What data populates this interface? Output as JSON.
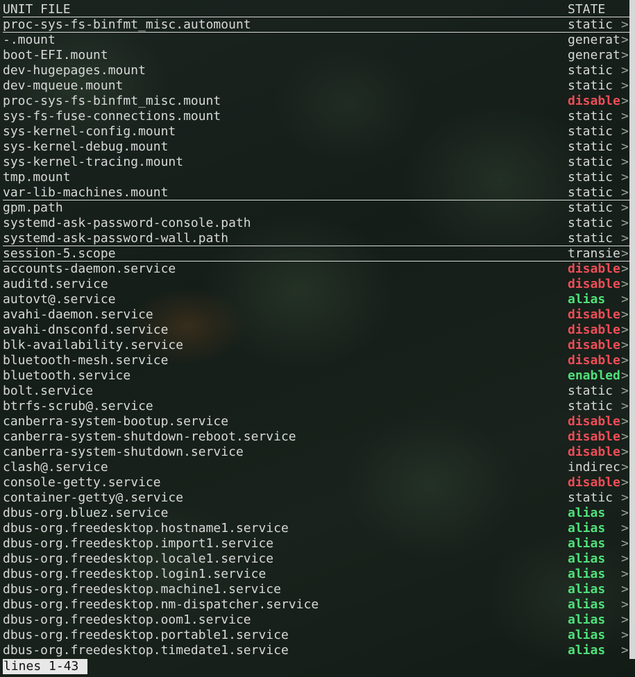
{
  "header": {
    "unit_file": "UNIT FILE",
    "state": "STATE"
  },
  "truncation_marker": ">",
  "rows": [
    {
      "name": "proc-sys-fs-binfmt_misc.automount",
      "state": "static",
      "kind": "static",
      "underline": true
    },
    {
      "name": "-.mount",
      "state": "generat",
      "kind": "static",
      "underline": false
    },
    {
      "name": "boot-EFI.mount",
      "state": "generat",
      "kind": "static",
      "underline": false
    },
    {
      "name": "dev-hugepages.mount",
      "state": "static",
      "kind": "static",
      "underline": false
    },
    {
      "name": "dev-mqueue.mount",
      "state": "static",
      "kind": "static",
      "underline": false
    },
    {
      "name": "proc-sys-fs-binfmt_misc.mount",
      "state": "disable",
      "kind": "disabled",
      "underline": false
    },
    {
      "name": "sys-fs-fuse-connections.mount",
      "state": "static",
      "kind": "static",
      "underline": false
    },
    {
      "name": "sys-kernel-config.mount",
      "state": "static",
      "kind": "static",
      "underline": false
    },
    {
      "name": "sys-kernel-debug.mount",
      "state": "static",
      "kind": "static",
      "underline": false
    },
    {
      "name": "sys-kernel-tracing.mount",
      "state": "static",
      "kind": "static",
      "underline": false
    },
    {
      "name": "tmp.mount",
      "state": "static",
      "kind": "static",
      "underline": false
    },
    {
      "name": "var-lib-machines.mount",
      "state": "static",
      "kind": "static",
      "underline": true
    },
    {
      "name": "gpm.path",
      "state": "static",
      "kind": "static",
      "underline": false
    },
    {
      "name": "systemd-ask-password-console.path",
      "state": "static",
      "kind": "static",
      "underline": false
    },
    {
      "name": "systemd-ask-password-wall.path",
      "state": "static",
      "kind": "static",
      "underline": true
    },
    {
      "name": "session-5.scope",
      "state": "transie",
      "kind": "static",
      "underline": true
    },
    {
      "name": "accounts-daemon.service",
      "state": "disable",
      "kind": "disabled",
      "underline": false
    },
    {
      "name": "auditd.service",
      "state": "disable",
      "kind": "disabled",
      "underline": false
    },
    {
      "name": "autovt@.service",
      "state": "alias",
      "kind": "alias",
      "underline": false
    },
    {
      "name": "avahi-daemon.service",
      "state": "disable",
      "kind": "disabled",
      "underline": false
    },
    {
      "name": "avahi-dnsconfd.service",
      "state": "disable",
      "kind": "disabled",
      "underline": false
    },
    {
      "name": "blk-availability.service",
      "state": "disable",
      "kind": "disabled",
      "underline": false
    },
    {
      "name": "bluetooth-mesh.service",
      "state": "disable",
      "kind": "disabled",
      "underline": false
    },
    {
      "name": "bluetooth.service",
      "state": "enabled",
      "kind": "enabled",
      "underline": false
    },
    {
      "name": "bolt.service",
      "state": "static",
      "kind": "static",
      "underline": false
    },
    {
      "name": "btrfs-scrub@.service",
      "state": "static",
      "kind": "static",
      "underline": false
    },
    {
      "name": "canberra-system-bootup.service",
      "state": "disable",
      "kind": "disabled",
      "underline": false
    },
    {
      "name": "canberra-system-shutdown-reboot.service",
      "state": "disable",
      "kind": "disabled",
      "underline": false
    },
    {
      "name": "canberra-system-shutdown.service",
      "state": "disable",
      "kind": "disabled",
      "underline": false
    },
    {
      "name": "clash@.service",
      "state": "indirec",
      "kind": "static",
      "underline": false
    },
    {
      "name": "console-getty.service",
      "state": "disable",
      "kind": "disabled",
      "underline": false
    },
    {
      "name": "container-getty@.service",
      "state": "static",
      "kind": "static",
      "underline": false
    },
    {
      "name": "dbus-org.bluez.service",
      "state": "alias",
      "kind": "alias",
      "underline": false
    },
    {
      "name": "dbus-org.freedesktop.hostname1.service",
      "state": "alias",
      "kind": "alias",
      "underline": false
    },
    {
      "name": "dbus-org.freedesktop.import1.service",
      "state": "alias",
      "kind": "alias",
      "underline": false
    },
    {
      "name": "dbus-org.freedesktop.locale1.service",
      "state": "alias",
      "kind": "alias",
      "underline": false
    },
    {
      "name": "dbus-org.freedesktop.login1.service",
      "state": "alias",
      "kind": "alias",
      "underline": false
    },
    {
      "name": "dbus-org.freedesktop.machine1.service",
      "state": "alias",
      "kind": "alias",
      "underline": false
    },
    {
      "name": "dbus-org.freedesktop.nm-dispatcher.service",
      "state": "alias",
      "kind": "alias",
      "underline": false
    },
    {
      "name": "dbus-org.freedesktop.oom1.service",
      "state": "alias",
      "kind": "alias",
      "underline": false
    },
    {
      "name": "dbus-org.freedesktop.portable1.service",
      "state": "alias",
      "kind": "alias",
      "underline": false
    },
    {
      "name": "dbus-org.freedesktop.timedate1.service",
      "state": "alias",
      "kind": "alias",
      "underline": false
    }
  ],
  "status_line": "lines 1-43",
  "colors": {
    "disabled": "#ef4d57",
    "enabled": "#4fe07a",
    "alias": "#4fe07a",
    "text": "#d8d8d8"
  }
}
